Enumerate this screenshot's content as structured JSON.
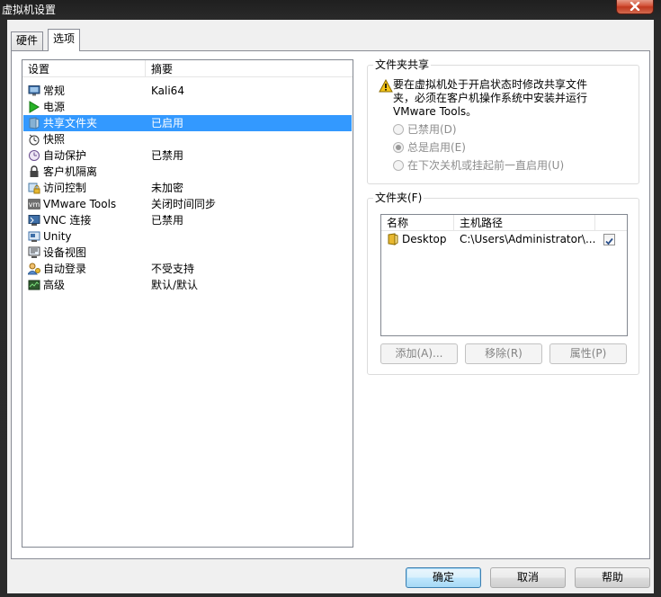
{
  "window": {
    "title": "虚拟机设置"
  },
  "tabs": [
    {
      "label": "硬件",
      "active": false
    },
    {
      "label": "选项",
      "active": true
    }
  ],
  "settings": {
    "col_setting": "设置",
    "col_summary": "摘要",
    "items": [
      {
        "name": "常规",
        "summary": "Kali64",
        "icon": "monitor-icon"
      },
      {
        "name": "电源",
        "summary": "",
        "icon": "play-icon"
      },
      {
        "name": "共享文件夹",
        "summary": "已启用",
        "icon": "shared-folder-icon",
        "selected": true
      },
      {
        "name": "快照",
        "summary": "",
        "icon": "snapshot-icon"
      },
      {
        "name": "自动保护",
        "summary": "已禁用",
        "icon": "clock-icon"
      },
      {
        "name": "客户机隔离",
        "summary": "",
        "icon": "lock-icon"
      },
      {
        "name": "访问控制",
        "summary": "未加密",
        "icon": "access-lock-icon"
      },
      {
        "name": "VMware Tools",
        "summary": "关闭时间同步",
        "icon": "vm-icon"
      },
      {
        "name": "VNC 连接",
        "summary": "已禁用",
        "icon": "vnc-icon"
      },
      {
        "name": "Unity",
        "summary": "",
        "icon": "unity-icon"
      },
      {
        "name": "设备视图",
        "summary": "",
        "icon": "device-view-icon"
      },
      {
        "name": "自动登录",
        "summary": "不受支持",
        "icon": "autologin-icon"
      },
      {
        "name": "高级",
        "summary": "默认/默认",
        "icon": "advanced-icon"
      }
    ]
  },
  "folder_sharing": {
    "title": "文件夹共享",
    "warning": "要在虚拟机处于开启状态时修改共享文件夹，必须在客户机操作系统中安装并运行 VMware Tools。",
    "options": [
      {
        "label": "已禁用(D)",
        "checked": false
      },
      {
        "label": "总是启用(E)",
        "checked": true
      },
      {
        "label": "在下次关机或挂起前一直启用(U)",
        "checked": false
      }
    ]
  },
  "folders": {
    "title": "文件夹(F)",
    "col_name": "名称",
    "col_path": "主机路径",
    "rows": [
      {
        "name": "Desktop",
        "path": "C:\\Users\\Administrator\\...",
        "enabled": true
      }
    ],
    "add_label": "添加(A)...",
    "remove_label": "移除(R)",
    "props_label": "属性(P)"
  },
  "footer": {
    "ok_label": "确定",
    "cancel_label": "取消",
    "help_label": "帮助"
  }
}
